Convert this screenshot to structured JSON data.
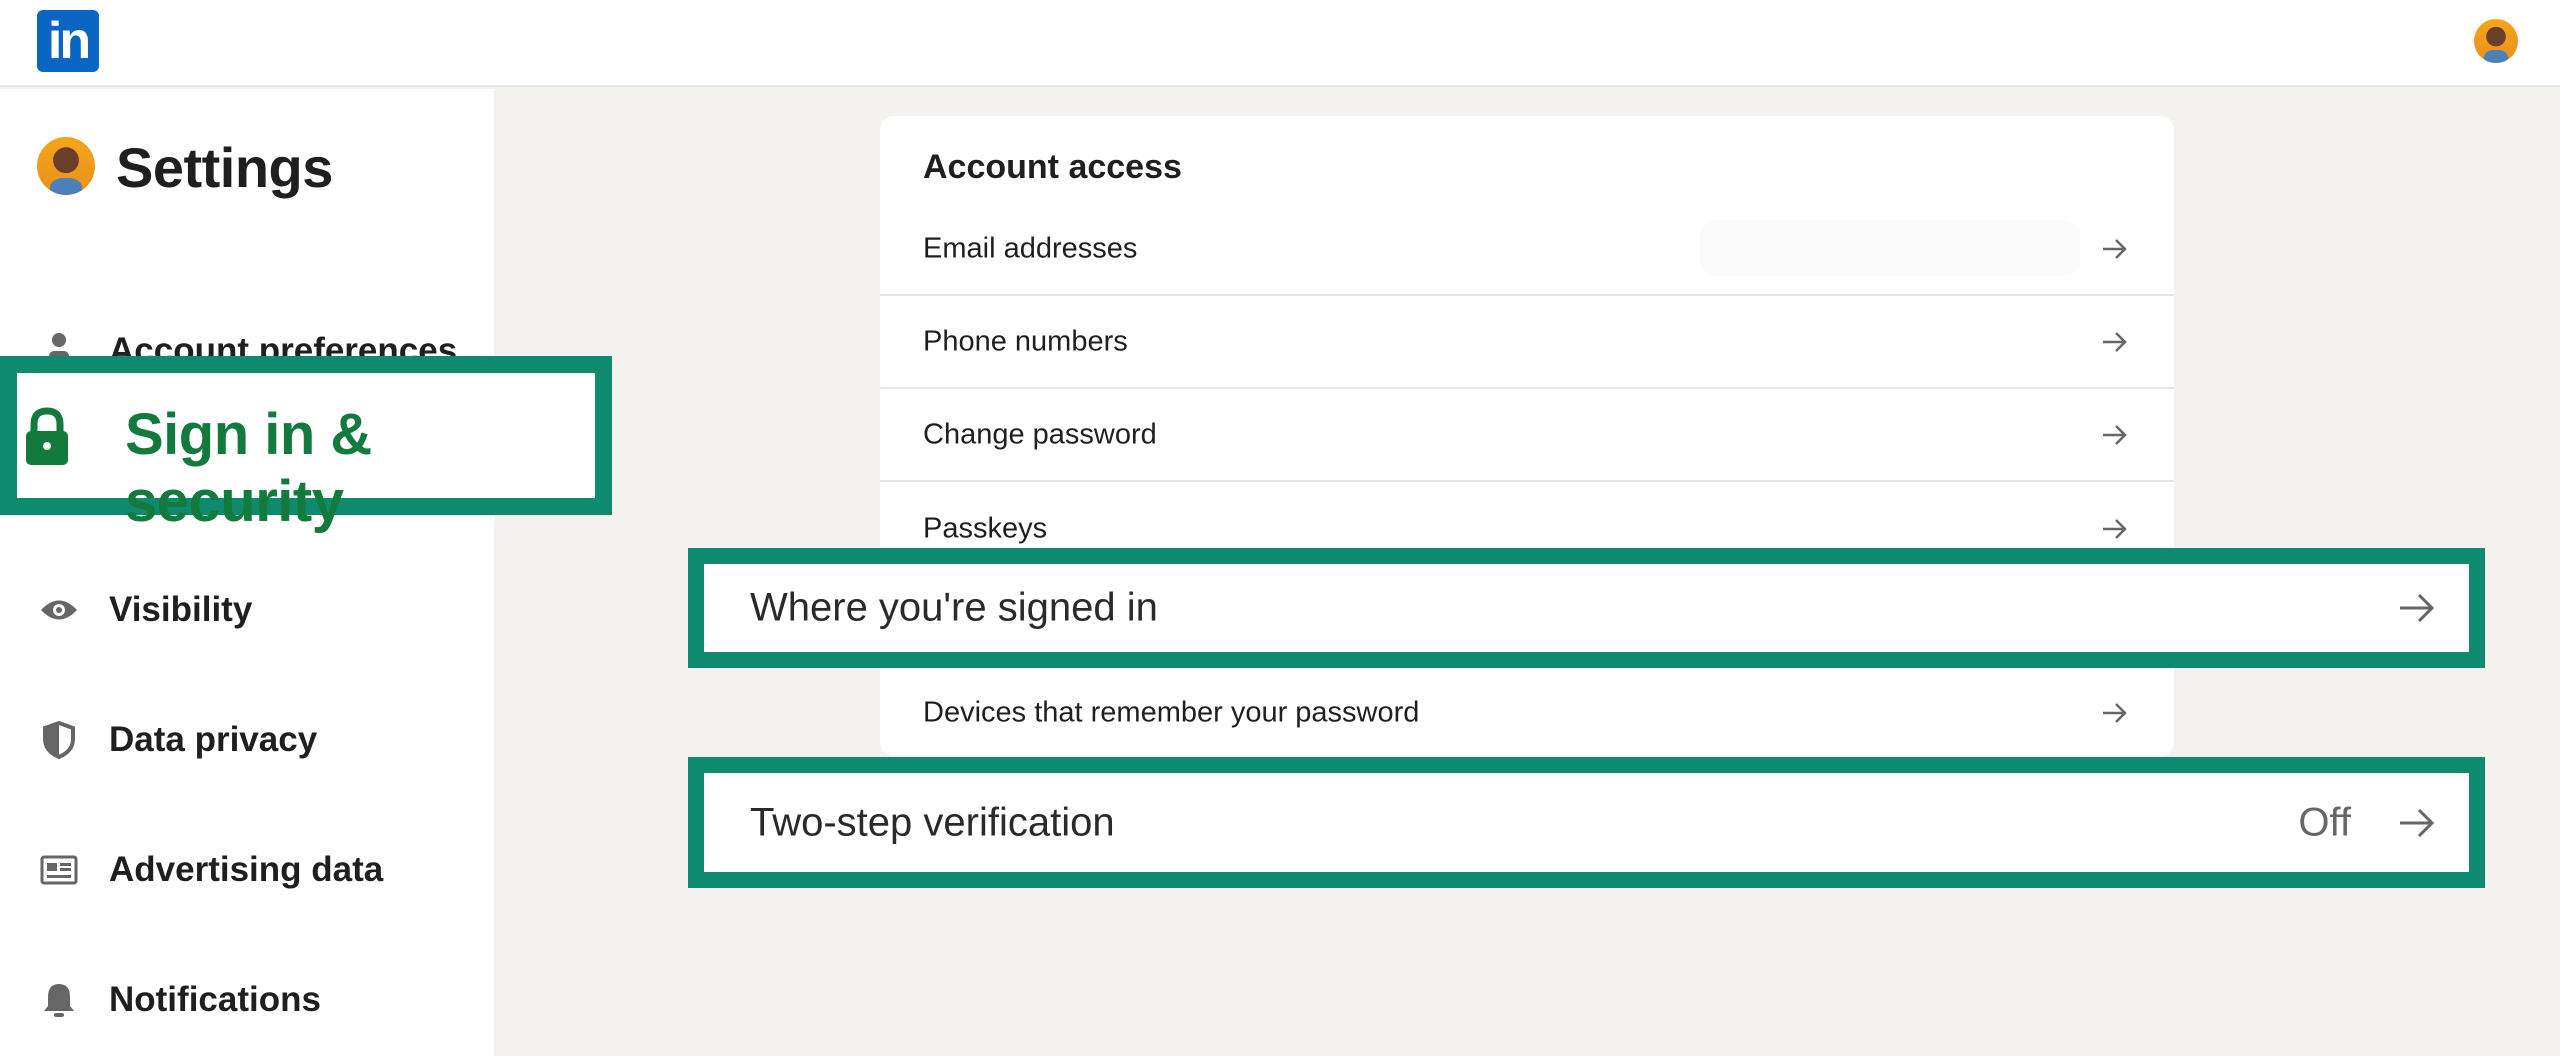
{
  "app": {
    "logo_text": "in"
  },
  "sidebar": {
    "title": "Settings",
    "items": [
      {
        "label": "Account preferences",
        "icon": "person-icon"
      },
      {
        "label": "Sign in & security",
        "icon": "lock-icon",
        "active": true
      },
      {
        "label": "Visibility",
        "icon": "eye-icon"
      },
      {
        "label": "Data privacy",
        "icon": "shield-icon"
      },
      {
        "label": "Advertising data",
        "icon": "ad-card-icon"
      },
      {
        "label": "Notifications",
        "icon": "bell-icon"
      }
    ]
  },
  "main": {
    "section_title": "Account access",
    "rows": [
      {
        "label": "Email addresses"
      },
      {
        "label": "Phone numbers"
      },
      {
        "label": "Change password"
      },
      {
        "label": "Passkeys"
      },
      {
        "label": "Where you're signed in",
        "highlighted": true
      },
      {
        "label": "Devices that remember your password"
      },
      {
        "label": "Two-step verification",
        "status": "Off",
        "highlighted": true
      }
    ]
  },
  "colors": {
    "highlight_border": "#0e8a6e",
    "active_text": "#127a3c",
    "brand": "#0a66c2",
    "page_bg": "#f4f2ee"
  }
}
